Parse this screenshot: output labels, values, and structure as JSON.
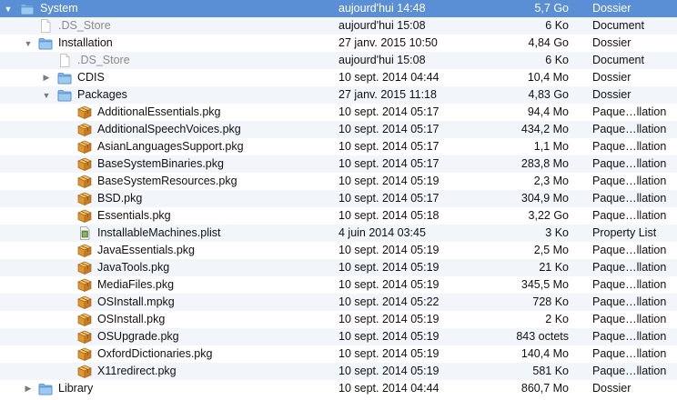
{
  "rows": [
    {
      "name": "System",
      "date": "aujourd'hui 14:48",
      "size": "5,7 Go",
      "kind": "Dossier",
      "level": 0,
      "icon": "folder",
      "disclosure": "open",
      "selected": true
    },
    {
      "name": ".DS_Store",
      "date": "aujourd'hui 15:08",
      "size": "6 Ko",
      "kind": "Document",
      "level": 1,
      "icon": "document",
      "disclosure": "none",
      "greyed": true
    },
    {
      "name": "Installation",
      "date": "27 janv. 2015 10:50",
      "size": "4,84 Go",
      "kind": "Dossier",
      "level": 1,
      "icon": "folder",
      "disclosure": "open"
    },
    {
      "name": ".DS_Store",
      "date": "aujourd'hui 15:08",
      "size": "6 Ko",
      "kind": "Document",
      "level": 2,
      "icon": "document",
      "disclosure": "none",
      "greyed": true
    },
    {
      "name": "CDIS",
      "date": "10 sept. 2014 04:44",
      "size": "10,4 Mo",
      "kind": "Dossier",
      "level": 2,
      "icon": "folder",
      "disclosure": "closed"
    },
    {
      "name": "Packages",
      "date": "27 janv. 2015 11:18",
      "size": "4,83 Go",
      "kind": "Dossier",
      "level": 2,
      "icon": "folder",
      "disclosure": "open"
    },
    {
      "name": "AdditionalEssentials.pkg",
      "date": "10 sept. 2014 05:17",
      "size": "94,4 Mo",
      "kind": "Paque…llation",
      "level": 3,
      "icon": "package",
      "disclosure": "none"
    },
    {
      "name": "AdditionalSpeechVoices.pkg",
      "date": "10 sept. 2014 05:17",
      "size": "434,2 Mo",
      "kind": "Paque…llation",
      "level": 3,
      "icon": "package",
      "disclosure": "none"
    },
    {
      "name": "AsianLanguagesSupport.pkg",
      "date": "10 sept. 2014 05:17",
      "size": "1,1 Mo",
      "kind": "Paque…llation",
      "level": 3,
      "icon": "package",
      "disclosure": "none"
    },
    {
      "name": "BaseSystemBinaries.pkg",
      "date": "10 sept. 2014 05:17",
      "size": "283,8 Mo",
      "kind": "Paque…llation",
      "level": 3,
      "icon": "package",
      "disclosure": "none"
    },
    {
      "name": "BaseSystemResources.pkg",
      "date": "10 sept. 2014 05:19",
      "size": "2,3 Mo",
      "kind": "Paque…llation",
      "level": 3,
      "icon": "package",
      "disclosure": "none"
    },
    {
      "name": "BSD.pkg",
      "date": "10 sept. 2014 05:17",
      "size": "304,9 Mo",
      "kind": "Paque…llation",
      "level": 3,
      "icon": "package",
      "disclosure": "none"
    },
    {
      "name": "Essentials.pkg",
      "date": "10 sept. 2014 05:18",
      "size": "3,22 Go",
      "kind": "Paque…llation",
      "level": 3,
      "icon": "package",
      "disclosure": "none"
    },
    {
      "name": "InstallableMachines.plist",
      "date": "4 juin 2014 03:45",
      "size": "3 Ko",
      "kind": "Property List",
      "level": 3,
      "icon": "plist",
      "disclosure": "none"
    },
    {
      "name": "JavaEssentials.pkg",
      "date": "10 sept. 2014 05:19",
      "size": "2,5 Mo",
      "kind": "Paque…llation",
      "level": 3,
      "icon": "package",
      "disclosure": "none"
    },
    {
      "name": "JavaTools.pkg",
      "date": "10 sept. 2014 05:19",
      "size": "21 Ko",
      "kind": "Paque…llation",
      "level": 3,
      "icon": "package",
      "disclosure": "none"
    },
    {
      "name": "MediaFiles.pkg",
      "date": "10 sept. 2014 05:19",
      "size": "345,5 Mo",
      "kind": "Paque…llation",
      "level": 3,
      "icon": "package",
      "disclosure": "none"
    },
    {
      "name": "OSInstall.mpkg",
      "date": "10 sept. 2014 05:22",
      "size": "728 Ko",
      "kind": "Paque…llation",
      "level": 3,
      "icon": "package",
      "disclosure": "none"
    },
    {
      "name": "OSInstall.pkg",
      "date": "10 sept. 2014 05:19",
      "size": "2 Ko",
      "kind": "Paque…llation",
      "level": 3,
      "icon": "package",
      "disclosure": "none"
    },
    {
      "name": "OSUpgrade.pkg",
      "date": "10 sept. 2014 05:19",
      "size": "843 octets",
      "kind": "Paque…llation",
      "level": 3,
      "icon": "package",
      "disclosure": "none"
    },
    {
      "name": "OxfordDictionaries.pkg",
      "date": "10 sept. 2014 05:19",
      "size": "140,4 Mo",
      "kind": "Paque…llation",
      "level": 3,
      "icon": "package",
      "disclosure": "none"
    },
    {
      "name": "X11redirect.pkg",
      "date": "10 sept. 2014 05:19",
      "size": "581 Ko",
      "kind": "Paque…llation",
      "level": 3,
      "icon": "package",
      "disclosure": "none"
    },
    {
      "name": "Library",
      "date": "10 sept. 2014 04:44",
      "size": "860,7 Mo",
      "kind": "Dossier",
      "level": 1,
      "icon": "folder",
      "disclosure": "closed"
    }
  ]
}
